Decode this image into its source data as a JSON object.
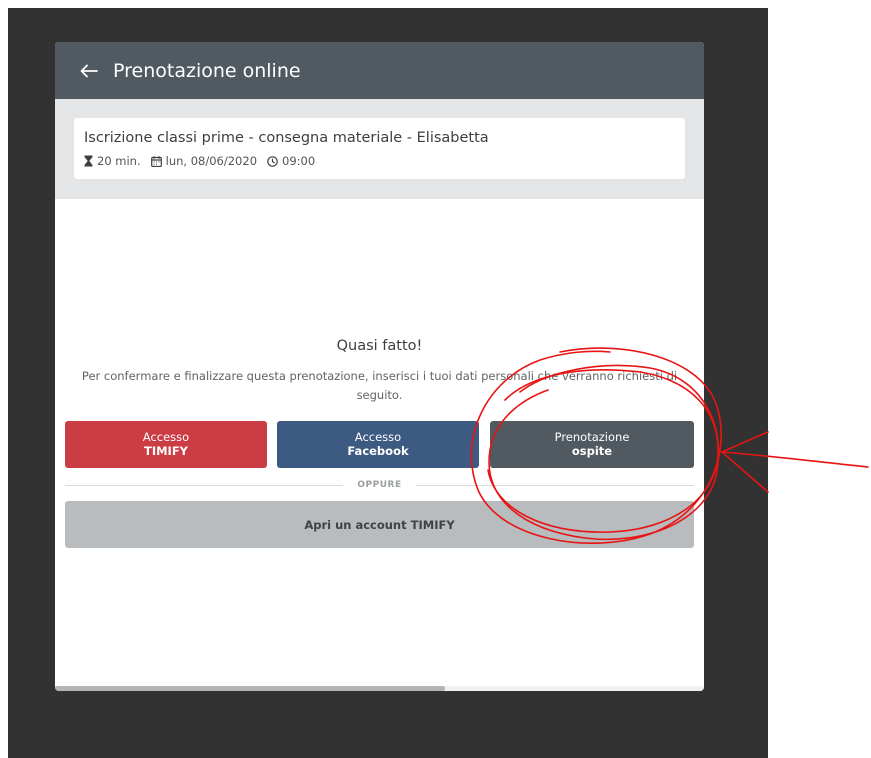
{
  "header": {
    "title": "Prenotazione online",
    "back_icon": "arrow-left-icon"
  },
  "summary": {
    "service_name": "Iscrizione classi prime - consegna materiale - Elisabetta",
    "duration": "20 min.",
    "date": "lun, 08/06/2020",
    "time": "09:00",
    "icons": [
      "hourglass-icon",
      "calendar-icon",
      "clock-icon"
    ]
  },
  "content": {
    "title": "Quasi fatto!",
    "description": "Per confermare e finalizzare questa prenotazione, inserisci i tuoi dati personali che verranno richiesti di seguito."
  },
  "buttons": {
    "timify": {
      "line1": "Accesso",
      "line2": "TIMIFY"
    },
    "facebook": {
      "line1": "Accesso",
      "line2": "Facebook"
    },
    "guest": {
      "line1": "Prenotazione",
      "line2": "ospite"
    }
  },
  "divider": {
    "label": "OPPURE"
  },
  "account_button": {
    "label": "Apri un account TIMIFY"
  },
  "colors": {
    "header": "#515a60",
    "timify": "#cb3c44",
    "facebook": "#3c5a82",
    "guest": "#515a60",
    "account": "#b8bcbf",
    "annotation": "#e81414"
  }
}
